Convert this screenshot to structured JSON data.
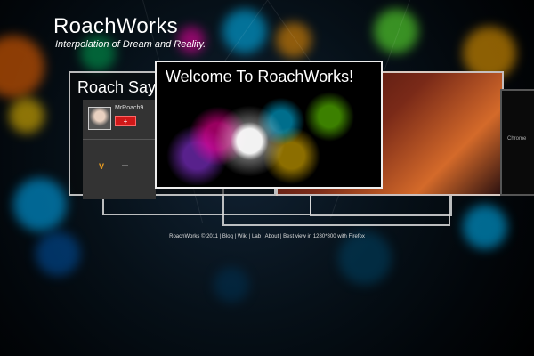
{
  "site": {
    "title": "RoachWorks",
    "tagline": "Interpolation of Dream and Reality."
  },
  "cards": {
    "roach_says": {
      "title": "Roach Say",
      "username": "MrRoach9",
      "add_button": "+",
      "v_icon": "V",
      "dash": "—"
    },
    "welcome": {
      "title": "Welcome To RoachWorks!"
    },
    "side": {
      "label": "Chrome"
    }
  },
  "footer": {
    "text": "RoachWorks © 2011 | Blog | Wiki | Lab | About | Best view in 1280*800 with Firefox"
  },
  "colors": {
    "accent_red": "#d01818",
    "frame": "#dcdcdc"
  }
}
